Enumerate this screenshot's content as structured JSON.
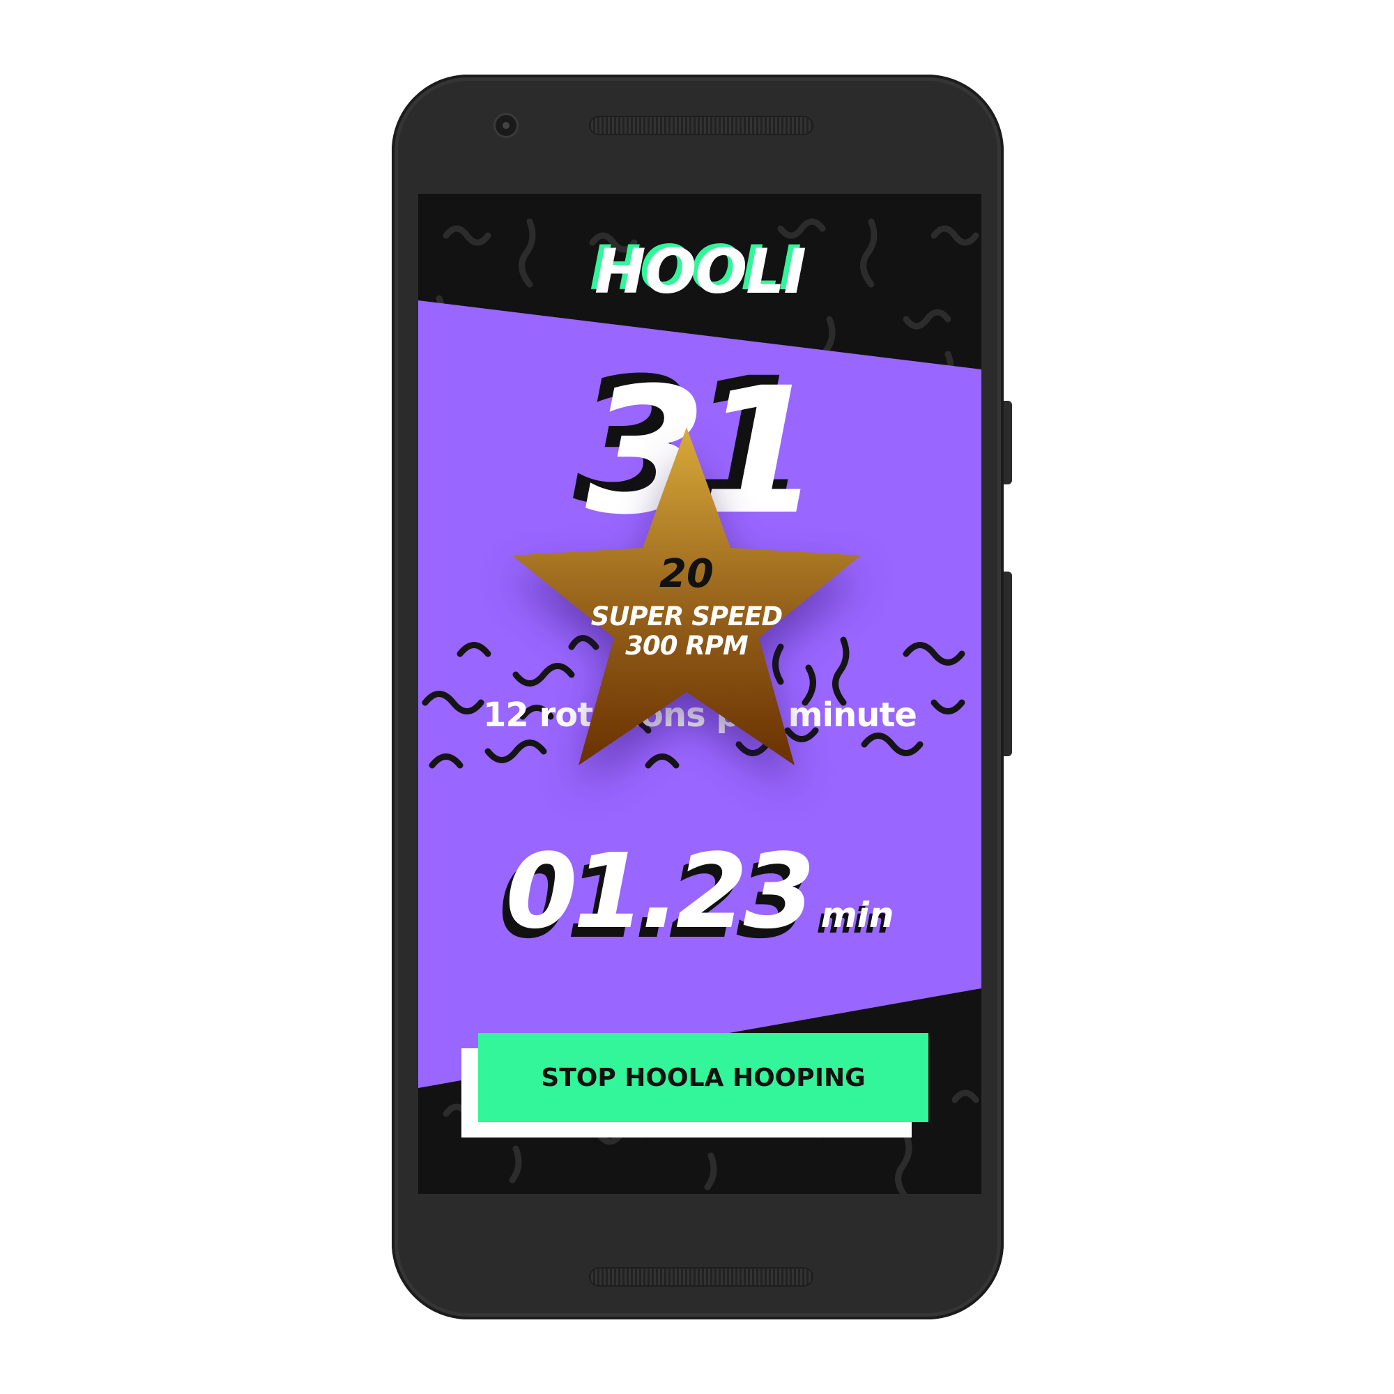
{
  "app": {
    "logo_text": "HOOLI"
  },
  "stats": {
    "rotations": "31",
    "rate_text": "12 rotations per minute",
    "timer_value": "01.23",
    "timer_unit": "min"
  },
  "achievement": {
    "number": "20",
    "title": "SUPER SPEED",
    "subtitle": "300 RPM"
  },
  "actions": {
    "stop_label": "STOP HOOLA HOOPING"
  },
  "colors": {
    "background": "#121212",
    "panel": "#9966ff",
    "accent": "#33f59a",
    "star_top": "#d9aa3a",
    "star_bottom": "#6a3100",
    "text": "#ffffff",
    "shadow_text": "#111111"
  }
}
